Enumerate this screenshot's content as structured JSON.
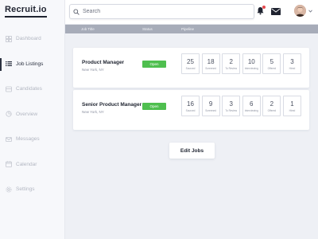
{
  "app": {
    "logo": "Recruit.io"
  },
  "sidebar": {
    "items": [
      {
        "label": "Dashboard",
        "icon": "dashboard-icon",
        "active": false
      },
      {
        "label": "Job Listings",
        "icon": "list-icon",
        "active": true
      },
      {
        "label": "Candidates",
        "icon": "candidates-icon",
        "active": false
      },
      {
        "label": "Overview",
        "icon": "overview-icon",
        "active": false
      },
      {
        "label": "Messages",
        "icon": "messages-icon",
        "active": false
      },
      {
        "label": "Calendar",
        "icon": "calendar-icon",
        "active": false
      },
      {
        "label": "Settings",
        "icon": "settings-icon",
        "active": false
      }
    ]
  },
  "header": {
    "search_placeholder": "Search",
    "notification_dot_color": "#e5484d"
  },
  "table": {
    "columns": [
      "Job Title",
      "Status",
      "Pipeline"
    ]
  },
  "jobs": [
    {
      "title": "Product Manager",
      "location": "New York, NY",
      "status": "Open",
      "pipeline": [
        {
          "value": "25",
          "label": "Sourced"
        },
        {
          "value": "18",
          "label": "Screened"
        },
        {
          "value": "2",
          "label": "To Review"
        },
        {
          "value": "10",
          "label": "Interviewing"
        },
        {
          "value": "5",
          "label": "Offered"
        },
        {
          "value": "3",
          "label": "Hired"
        }
      ]
    },
    {
      "title": "Senior Product Manager",
      "location": "New York, NY",
      "status": "Open",
      "pipeline": [
        {
          "value": "16",
          "label": "Sourced"
        },
        {
          "value": "9",
          "label": "Screened"
        },
        {
          "value": "3",
          "label": "To Review"
        },
        {
          "value": "6",
          "label": "Interviewing"
        },
        {
          "value": "2",
          "label": "Offered"
        },
        {
          "value": "1",
          "label": "Hired"
        }
      ]
    }
  ],
  "actions": {
    "edit_jobs_label": "Edit Jobs"
  },
  "colors": {
    "accent_green": "#4fbf4f",
    "header_strip": "#a7acb9"
  }
}
